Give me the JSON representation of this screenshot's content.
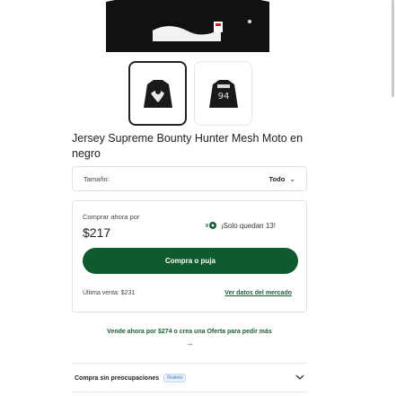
{
  "product": {
    "title": "Jersey Supreme Bounty Hunter Mesh Moto en negro",
    "hero_image": "jersey-black-back-icon",
    "thumbnails": [
      "jersey-front-thumbnail",
      "jersey-back-thumbnail"
    ],
    "selected_thumbnail": 0
  },
  "size": {
    "label": "Tamaño:",
    "value": "Todo"
  },
  "buy": {
    "label": "Comprar ahora por",
    "price": "$217",
    "stock_text": "¡Solo quedan 13!",
    "bid_button": "Compra o puja",
    "last_sale": "Última venta: $231",
    "market_link": "Ver datos del mercado"
  },
  "sell": {
    "promo": "Vende ahora por $274 o crea una Oferta para pedir más",
    "arrow": "→"
  },
  "worry_free": {
    "label": "Compra sin preocupaciones",
    "badge": "Nuevo"
  },
  "colors": {
    "accent_green": "#0f5b2f",
    "link_green": "#1b5e35",
    "badge_blue": "#4a7db8"
  }
}
